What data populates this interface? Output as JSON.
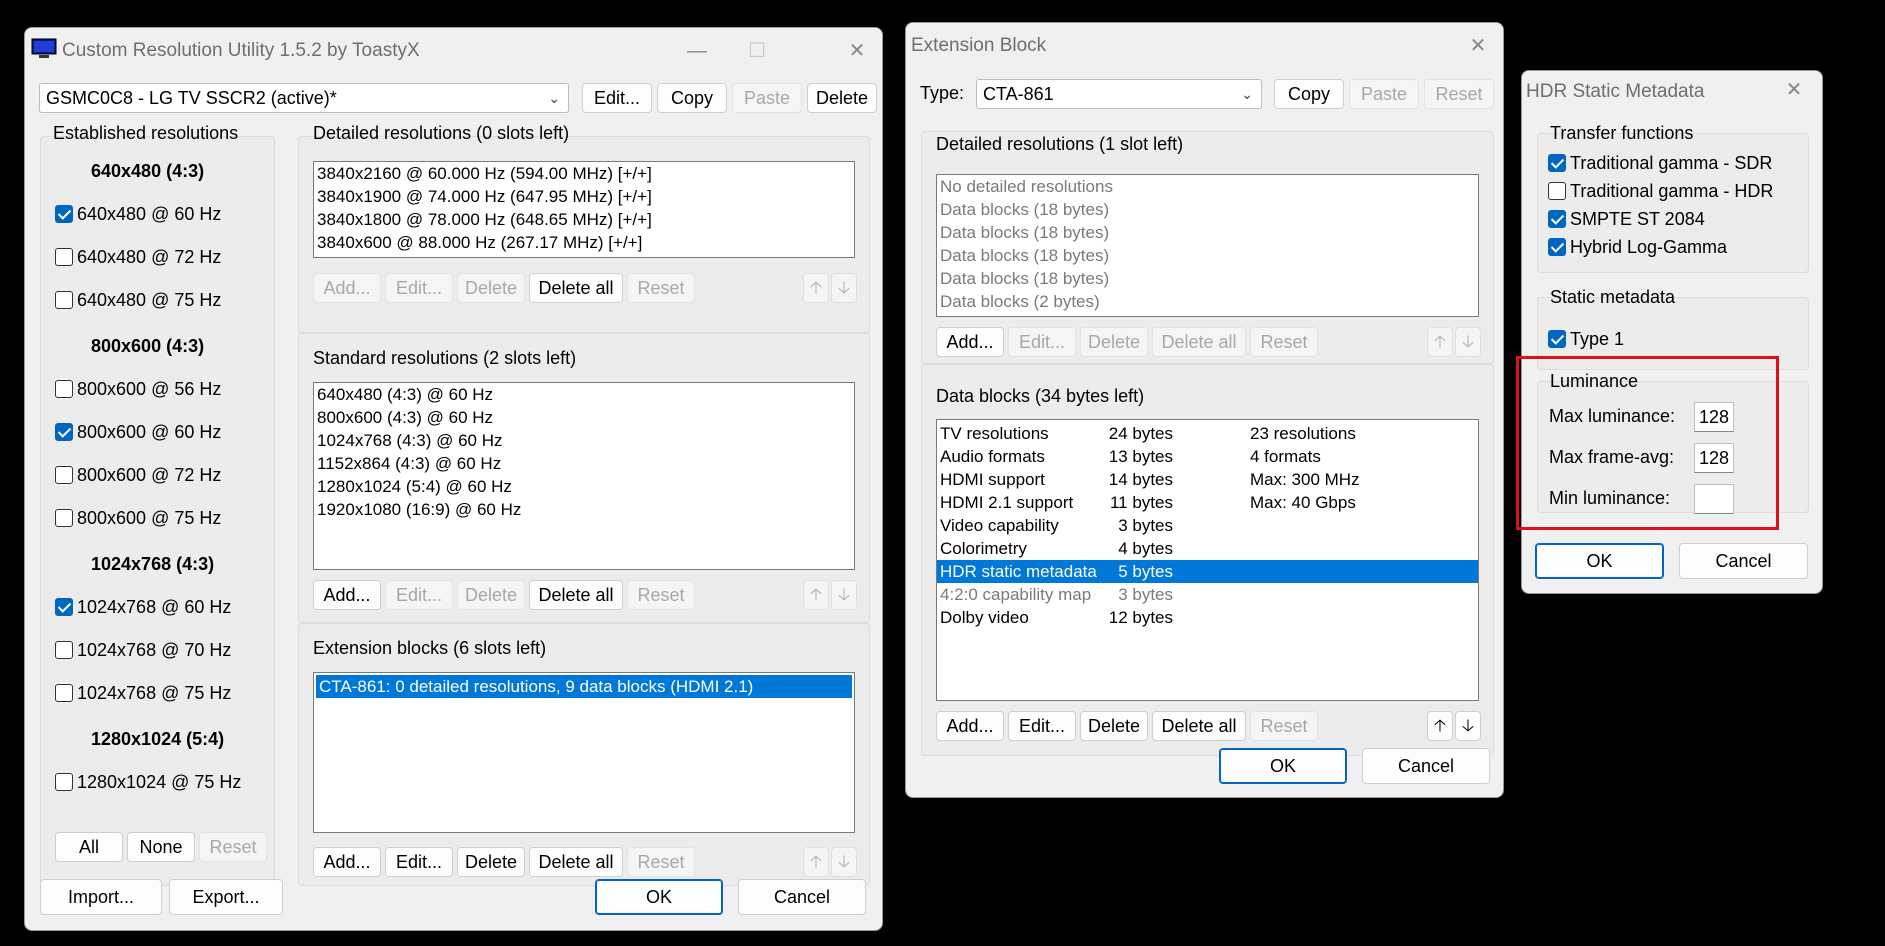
{
  "cru": {
    "title": "Custom Resolution Utility 1.5.2 by ToastyX",
    "icon": "monitor-icon",
    "monitor_select": "GSMC0C8 - LG TV SSCR2 (active)*",
    "top_buttons": {
      "edit": "Edit...",
      "copy": "Copy",
      "paste": "Paste",
      "delete": "Delete"
    },
    "established": {
      "label": "Established resolutions",
      "groups": [
        {
          "heading": "640x480 (4:3)",
          "items": [
            {
              "label": "640x480 @ 60 Hz",
              "checked": true
            },
            {
              "label": "640x480 @ 72 Hz",
              "checked": false
            },
            {
              "label": "640x480 @ 75 Hz",
              "checked": false
            }
          ]
        },
        {
          "heading": "800x600 (4:3)",
          "items": [
            {
              "label": "800x600 @ 56 Hz",
              "checked": false
            },
            {
              "label": "800x600 @ 60 Hz",
              "checked": true
            },
            {
              "label": "800x600 @ 72 Hz",
              "checked": false
            },
            {
              "label": "800x600 @ 75 Hz",
              "checked": false
            }
          ]
        },
        {
          "heading": "1024x768 (4:3)",
          "items": [
            {
              "label": "1024x768 @ 60 Hz",
              "checked": true
            },
            {
              "label": "1024x768 @ 70 Hz",
              "checked": false
            },
            {
              "label": "1024x768 @ 75 Hz",
              "checked": false
            }
          ]
        },
        {
          "heading": "1280x1024 (5:4)",
          "items": [
            {
              "label": "1280x1024 @ 75 Hz",
              "checked": false
            }
          ]
        }
      ],
      "buttons": {
        "all": "All",
        "none": "None",
        "reset": "Reset"
      }
    },
    "detailed": {
      "label": "Detailed resolutions (0 slots left)",
      "items": [
        "3840x2160 @ 60.000 Hz (594.00 MHz) [+/+]",
        "3840x1900 @ 74.000 Hz (647.95 MHz) [+/+]",
        "3840x1800 @ 78.000 Hz (648.65 MHz) [+/+]",
        "3840x600 @ 88.000 Hz (267.17 MHz) [+/+]"
      ]
    },
    "standard": {
      "label": "Standard resolutions (2 slots left)",
      "items": [
        "640x480 (4:3) @ 60 Hz",
        "800x600 (4:3) @ 60 Hz",
        "1024x768 (4:3) @ 60 Hz",
        "1152x864 (4:3) @ 60 Hz",
        "1280x1024 (5:4) @ 60 Hz",
        "1920x1080 (16:9) @ 60 Hz"
      ]
    },
    "extension": {
      "label": "Extension blocks (6 slots left)",
      "items": [
        "CTA-861: 0 detailed resolutions, 9 data blocks (HDMI 2.1)"
      ]
    },
    "list_buttons": {
      "add": "Add...",
      "edit": "Edit...",
      "delete": "Delete",
      "delete_all": "Delete all",
      "reset": "Reset"
    },
    "bottom": {
      "import": "Import...",
      "export": "Export...",
      "ok": "OK",
      "cancel": "Cancel"
    }
  },
  "ext": {
    "title": "Extension Block",
    "type_label": "Type:",
    "type_value": "CTA-861",
    "top_buttons": {
      "copy": "Copy",
      "paste": "Paste",
      "reset": "Reset"
    },
    "detailed": {
      "label": "Detailed resolutions (1 slot left)",
      "items": [
        "No detailed resolutions",
        "Data blocks (18 bytes)",
        "Data blocks (18 bytes)",
        "Data blocks (18 bytes)",
        "Data blocks (18 bytes)",
        "Data blocks (2 bytes)"
      ]
    },
    "data_blocks": {
      "label": "Data blocks (34 bytes left)",
      "rows": [
        {
          "name": "TV resolutions",
          "size": "24 bytes",
          "info": "23 resolutions"
        },
        {
          "name": "Audio formats",
          "size": "13 bytes",
          "info": "4 formats"
        },
        {
          "name": "HDMI support",
          "size": "14 bytes",
          "info": "Max: 300 MHz"
        },
        {
          "name": "HDMI 2.1 support",
          "size": "11 bytes",
          "info": "Max: 40 Gbps"
        },
        {
          "name": "Video capability",
          "size": "3 bytes",
          "info": ""
        },
        {
          "name": "Colorimetry",
          "size": "4 bytes",
          "info": ""
        },
        {
          "name": "HDR static metadata",
          "size": "5 bytes",
          "info": ""
        },
        {
          "name": "4:2:0 capability map",
          "size": "3 bytes",
          "info": ""
        },
        {
          "name": "Dolby video",
          "size": "12 bytes",
          "info": ""
        }
      ]
    },
    "list_buttons": {
      "add": "Add...",
      "edit": "Edit...",
      "delete": "Delete",
      "delete_all": "Delete all",
      "reset": "Reset"
    },
    "ok": "OK",
    "cancel": "Cancel"
  },
  "hdr": {
    "title": "HDR Static Metadata",
    "transfer": {
      "label": "Transfer functions",
      "items": [
        {
          "label": "Traditional gamma - SDR",
          "checked": true
        },
        {
          "label": "Traditional gamma - HDR",
          "checked": false
        },
        {
          "label": "SMPTE ST 2084",
          "checked": true
        },
        {
          "label": "Hybrid Log-Gamma",
          "checked": true
        }
      ]
    },
    "static": {
      "label": "Static metadata",
      "items": [
        {
          "label": "Type 1",
          "checked": true
        }
      ]
    },
    "luminance": {
      "label": "Luminance",
      "max_label": "Max luminance:",
      "max_value": "128",
      "frame_label": "Max frame-avg:",
      "frame_value": "128",
      "min_label": "Min luminance:",
      "min_value": ""
    },
    "ok": "OK",
    "cancel": "Cancel"
  },
  "colors": {
    "highlight": "#e0101a",
    "selection": "#0078d7",
    "accent": "#0067c0"
  }
}
